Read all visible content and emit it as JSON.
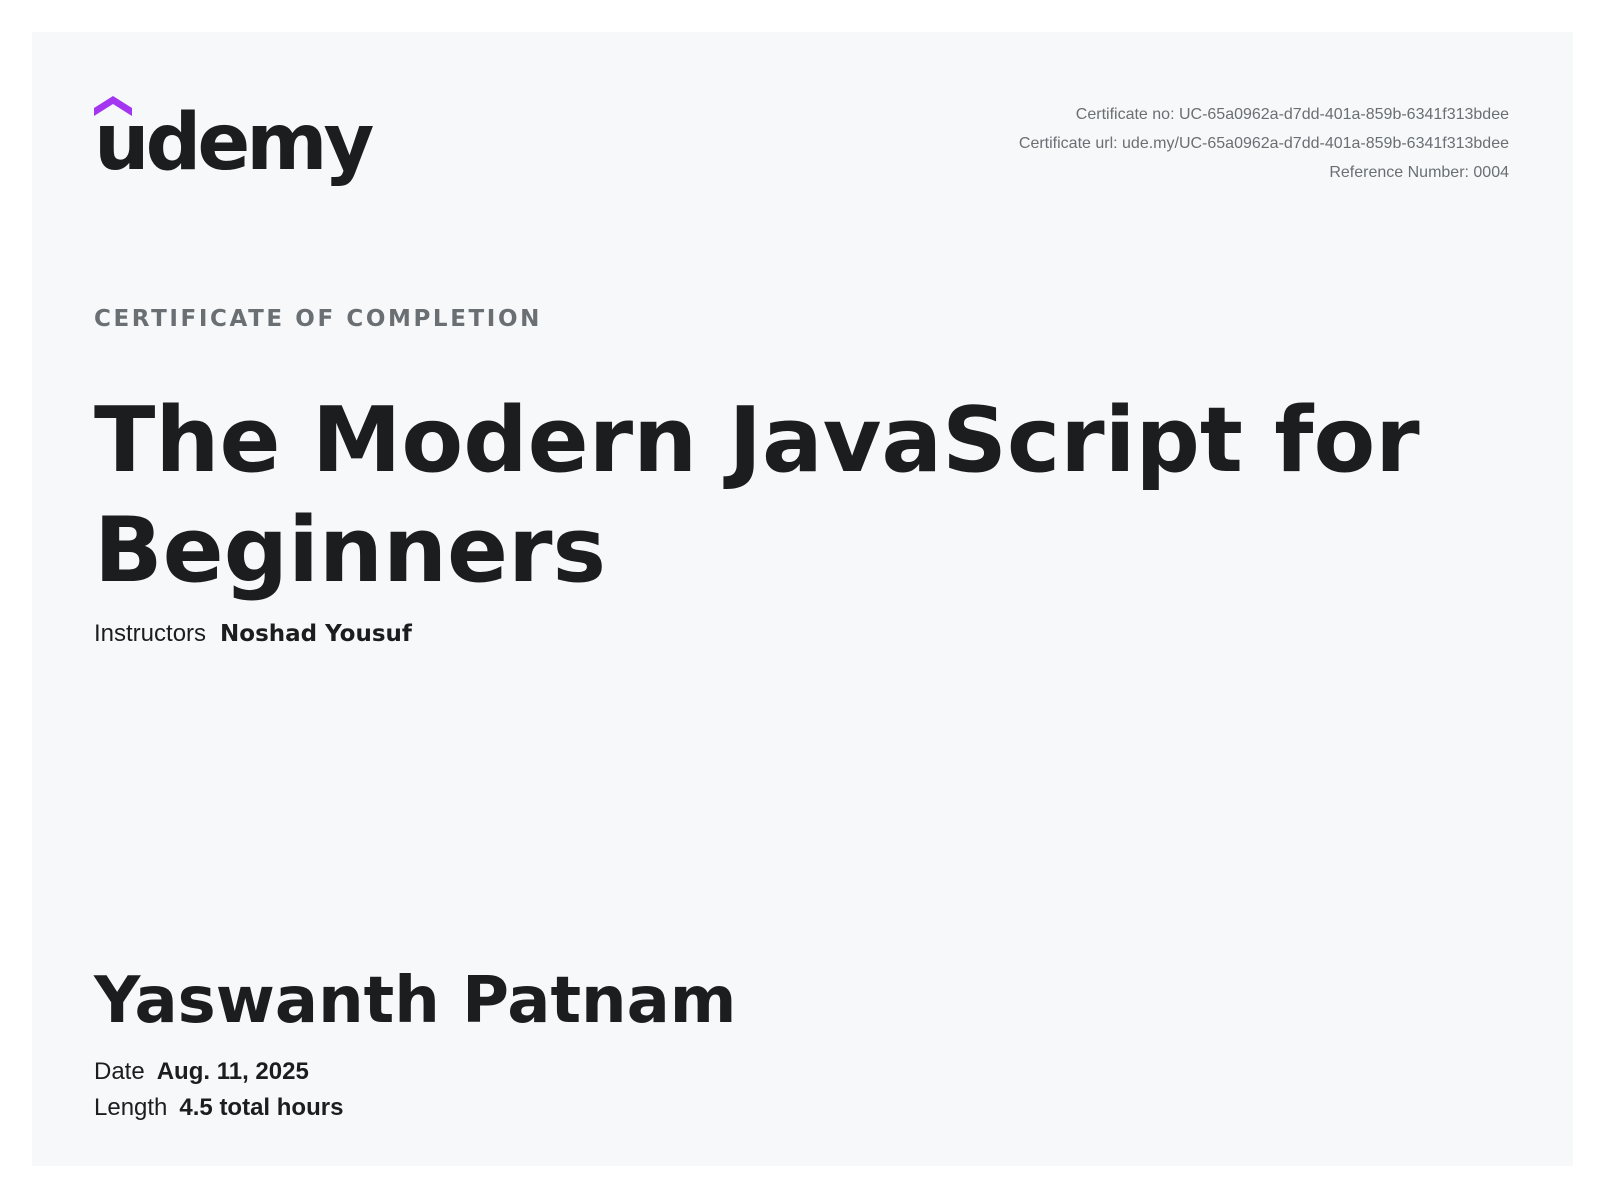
{
  "brand": {
    "name": "udemy",
    "accent_color": "#a435f0",
    "text_color": "#1c1d1f"
  },
  "certificate": {
    "number_line": "Certificate no: UC-65a0962a-d7dd-401a-859b-6341f313bdee",
    "url_line": "Certificate url: ude.my/UC-65a0962a-d7dd-401a-859b-6341f313bdee",
    "reference_line": "Reference Number: 0004",
    "label": "CERTIFICATE OF COMPLETION",
    "course_title": "The Modern JavaScript for Beginners",
    "instructors_label": "Instructors",
    "instructors_value": "Noshad Yousuf",
    "student_name": "Yaswanth Patnam",
    "date_label": "Date",
    "date_value": "Aug. 11, 2025",
    "length_label": "Length",
    "length_value": "4.5 total hours"
  }
}
